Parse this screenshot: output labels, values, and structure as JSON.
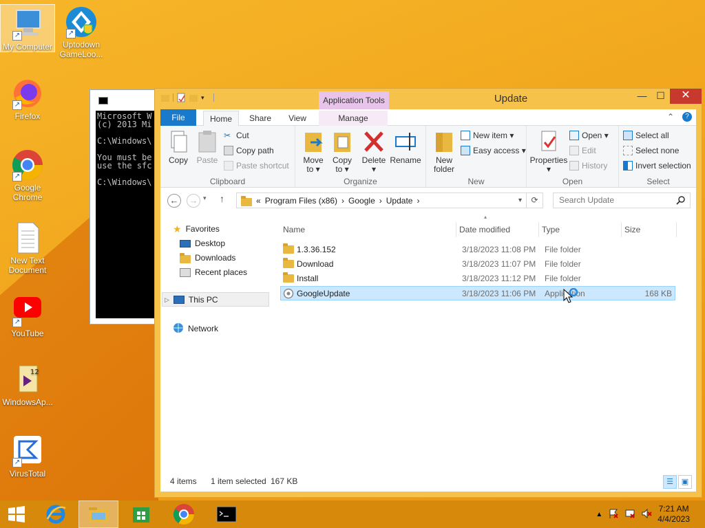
{
  "desktop": {
    "icons": [
      {
        "label": "My Computer"
      },
      {
        "label": "Uptodown GameLoo..."
      },
      {
        "label": "Firefox"
      },
      {
        "label": "Google Chrome"
      },
      {
        "label": "New Text Document"
      },
      {
        "label": "YouTube"
      },
      {
        "label": "WindowsAp..."
      },
      {
        "label": "VirusTotal"
      }
    ]
  },
  "cmd": {
    "text": "Microsoft W\n(c) 2013 Mi\n\nC:\\Windows\\\n\nYou must be\nuse the sfc\n\nC:\\Windows\\"
  },
  "explorer": {
    "title": "Update",
    "context_tab_group": "Application Tools",
    "tabs": {
      "file": "File",
      "home": "Home",
      "share": "Share",
      "view": "View",
      "manage": "Manage"
    },
    "ribbon": {
      "clipboard": {
        "label": "Clipboard",
        "copy": "Copy",
        "paste": "Paste",
        "cut": "Cut",
        "copy_path": "Copy path",
        "paste_shortcut": "Paste shortcut"
      },
      "organize": {
        "label": "Organize",
        "move_to": "Move to ▾",
        "copy_to": "Copy to ▾",
        "delete": "Delete ▾",
        "rename": "Rename"
      },
      "new": {
        "label": "New",
        "new_folder": "New folder",
        "new_item": "New item ▾",
        "easy_access": "Easy access ▾"
      },
      "open": {
        "label": "Open",
        "properties": "Properties ▾",
        "open": "Open ▾",
        "edit": "Edit",
        "history": "History"
      },
      "select": {
        "label": "Select",
        "select_all": "Select all",
        "select_none": "Select none",
        "invert_selection": "Invert selection"
      }
    },
    "address": {
      "prefix": "«",
      "crumbs": [
        "Program Files (x86)",
        "Google",
        "Update"
      ]
    },
    "search": {
      "placeholder": "Search Update"
    },
    "nav": {
      "favorites": "Favorites",
      "desktop": "Desktop",
      "downloads": "Downloads",
      "recent_places": "Recent places",
      "this_pc": "This PC",
      "network": "Network"
    },
    "columns": {
      "name": "Name",
      "date": "Date modified",
      "type": "Type",
      "size": "Size"
    },
    "files": [
      {
        "name": "1.3.36.152",
        "date": "3/18/2023 11:08 PM",
        "type": "File folder",
        "size": ""
      },
      {
        "name": "Download",
        "date": "3/18/2023 11:07 PM",
        "type": "File folder",
        "size": ""
      },
      {
        "name": "Install",
        "date": "3/18/2023 11:12 PM",
        "type": "File folder",
        "size": ""
      },
      {
        "name": "GoogleUpdate",
        "date": "3/18/2023 11:06 PM",
        "type": "Application",
        "size": "168 KB"
      }
    ],
    "status": {
      "count": "4 items",
      "selected": "1 item selected",
      "size": "167 KB"
    }
  },
  "taskbar": {
    "time": "7:21 AM",
    "date": "4/4/2023"
  },
  "colors": {
    "accent": "#1979ca",
    "close": "#c7392c",
    "selection": "#cce8ff",
    "window_frame": "#f6c24a"
  }
}
